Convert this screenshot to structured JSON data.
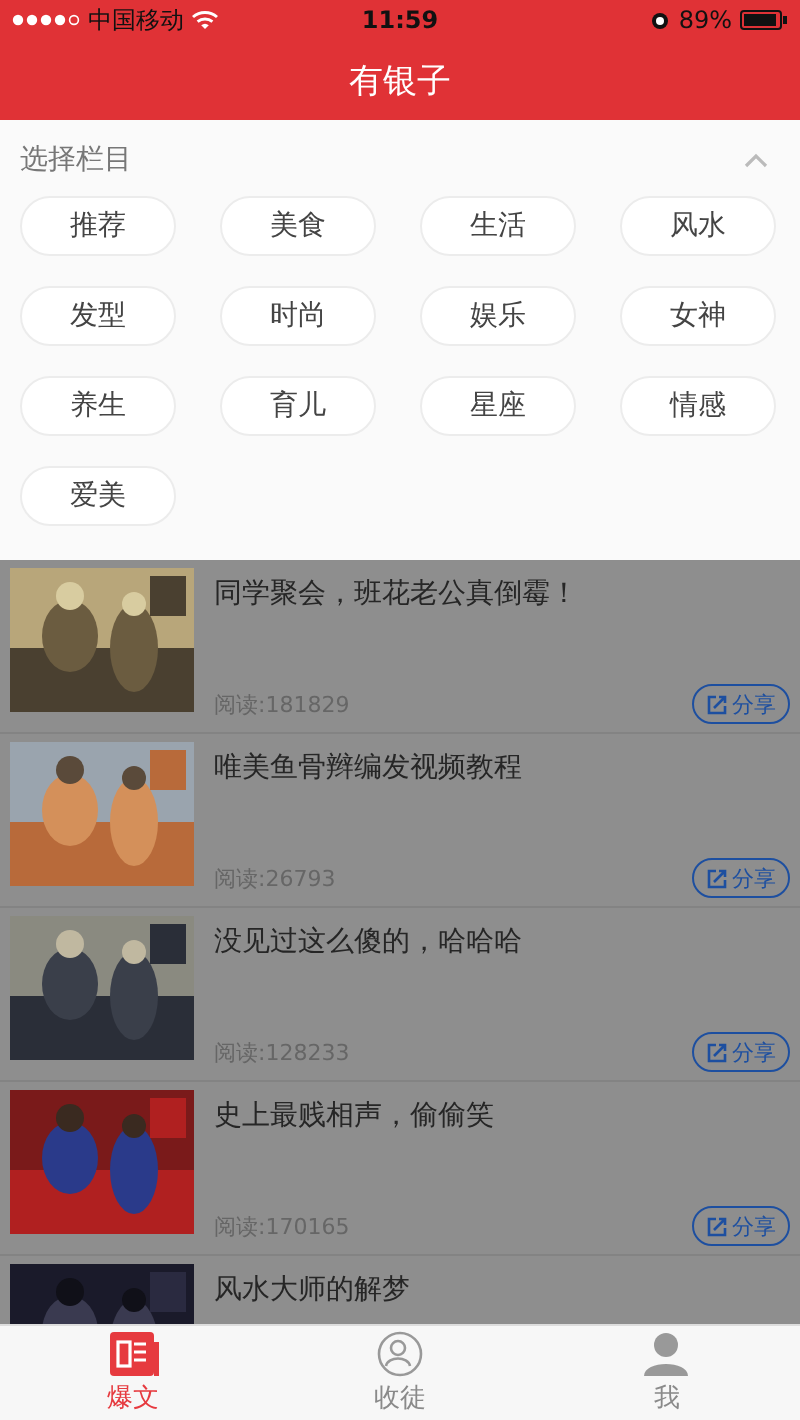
{
  "status_bar": {
    "carrier": "中国移动",
    "time": "11:59",
    "battery": "89%"
  },
  "header": {
    "title": "有银子"
  },
  "column_picker": {
    "title": "选择栏目",
    "chips": [
      {
        "label": "推荐"
      },
      {
        "label": "美食"
      },
      {
        "label": "生活"
      },
      {
        "label": "风水"
      },
      {
        "label": "发型"
      },
      {
        "label": "时尚"
      },
      {
        "label": "娱乐"
      },
      {
        "label": "女神"
      },
      {
        "label": "养生"
      },
      {
        "label": "育儿"
      },
      {
        "label": "星座"
      },
      {
        "label": "情感"
      },
      {
        "label": "爱美"
      }
    ]
  },
  "articles": [
    {
      "title": "同学聚会，班花老公真倒霉！",
      "reads": "阅读:181829",
      "share": "分享"
    },
    {
      "title": "唯美鱼骨辫编发视频教程",
      "reads": "阅读:26793",
      "share": "分享"
    },
    {
      "title": "没见过这么傻的，哈哈哈",
      "reads": "阅读:128233",
      "share": "分享"
    },
    {
      "title": "史上最贱相声，偷偷笑",
      "reads": "阅读:170165",
      "share": "分享"
    },
    {
      "title": "风水大师的解梦"
    }
  ],
  "tab_bar": [
    {
      "label": "爆文",
      "selected": true
    },
    {
      "label": "收徒",
      "selected": false
    },
    {
      "label": "我",
      "selected": false
    }
  ]
}
